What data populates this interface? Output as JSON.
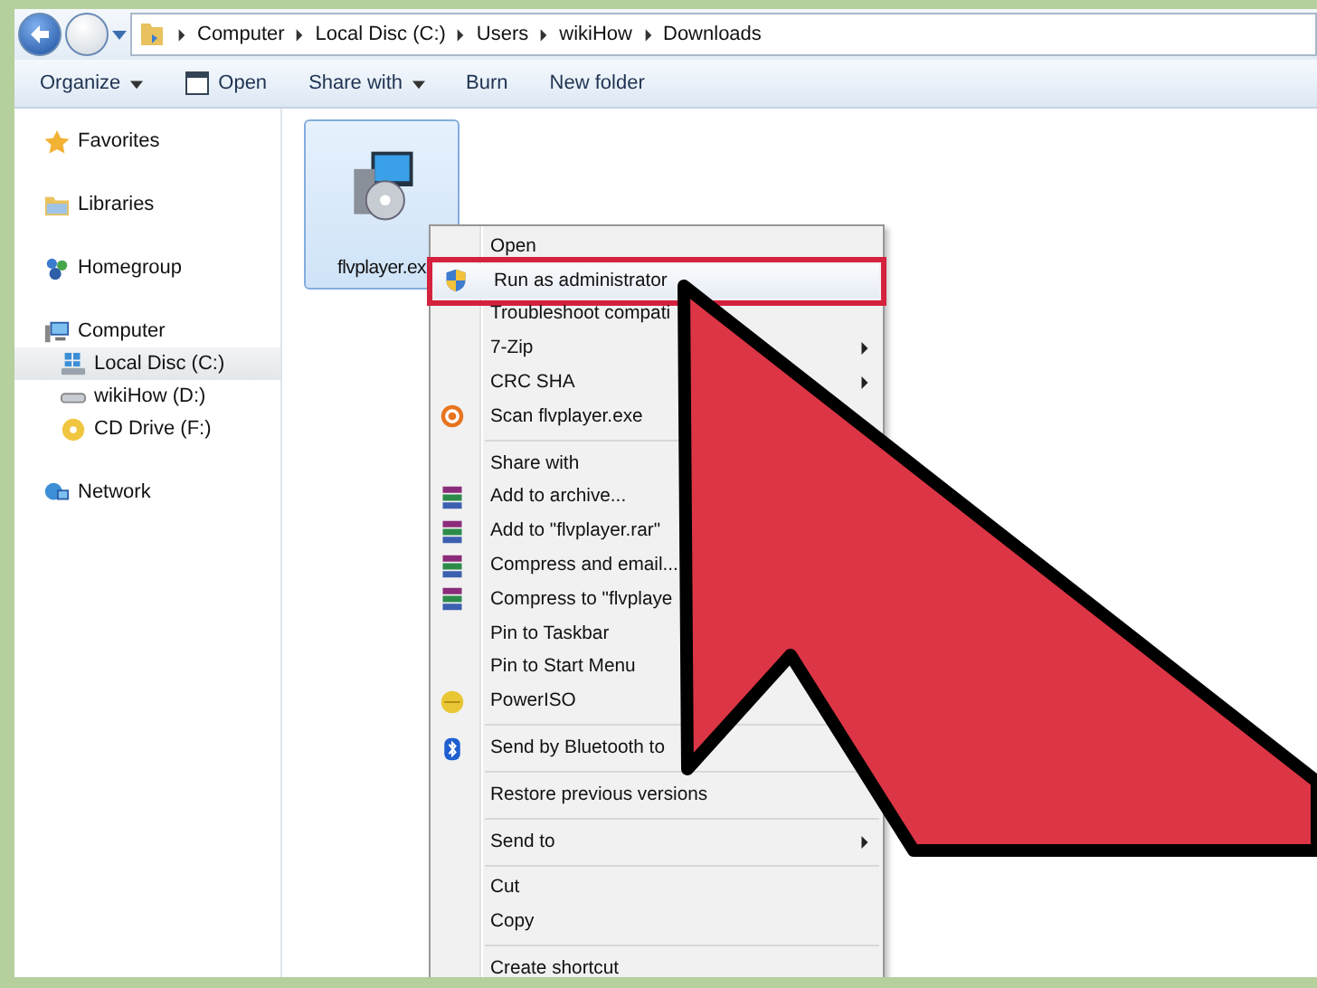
{
  "address_bar": {
    "path": [
      "Computer",
      "Local Disc (C:)",
      "Users",
      "wikiHow",
      "Downloads"
    ]
  },
  "toolbar": [
    {
      "label": "Organize",
      "dropdown": true
    },
    {
      "label": "Open",
      "dropdown": false
    },
    {
      "label": "Share with",
      "dropdown": true
    },
    {
      "label": "Burn",
      "dropdown": false
    },
    {
      "label": "New folder",
      "dropdown": false
    }
  ],
  "sidebar": {
    "items": [
      {
        "label": "Favorites",
        "selected": false
      },
      {
        "label": "Libraries",
        "selected": false
      },
      {
        "label": "Homegroup",
        "selected": false
      },
      {
        "label": "Computer",
        "selected": false,
        "children": [
          {
            "label": "Local Disc (C:)",
            "selected": true
          },
          {
            "label": "wikiHow (D:)",
            "selected": false
          },
          {
            "label": "CD Drive (F:)",
            "selected": false
          }
        ]
      },
      {
        "label": "Network",
        "selected": false
      }
    ]
  },
  "files": [
    {
      "name": "flvplayer.ex",
      "selected": true
    }
  ],
  "context_menu": [
    {
      "kind": "item",
      "label": "Open",
      "submenu": false,
      "selected": false
    },
    {
      "kind": "item",
      "label": "Run as administrator",
      "submenu": false,
      "selected": true
    },
    {
      "kind": "item",
      "label": "Troubleshoot compati",
      "submenu": false,
      "selected": false
    },
    {
      "kind": "item",
      "label": "7-Zip",
      "submenu": true,
      "selected": false
    },
    {
      "kind": "item",
      "label": "CRC SHA",
      "submenu": true,
      "selected": false
    },
    {
      "kind": "item",
      "label": "Scan flvplayer.exe",
      "submenu": false,
      "selected": false
    },
    {
      "kind": "separator"
    },
    {
      "kind": "item",
      "label": "Share with",
      "selected": false
    },
    {
      "kind": "item",
      "label": "Add to archive...",
      "selected": false
    },
    {
      "kind": "item",
      "label": "Add to \"flvplayer.rar\"",
      "selected": false
    },
    {
      "kind": "item",
      "label": "Compress and email...",
      "selected": false
    },
    {
      "kind": "item",
      "label": "Compress to \"flvplaye",
      "selected": false
    },
    {
      "kind": "item",
      "label": "Pin to Taskbar",
      "selected": false
    },
    {
      "kind": "item",
      "label": "Pin to Start Menu",
      "selected": false
    },
    {
      "kind": "item",
      "label": "PowerISO",
      "selected": false
    },
    {
      "kind": "separator"
    },
    {
      "kind": "item",
      "label": "Send by Bluetooth to",
      "selected": false
    },
    {
      "kind": "separator"
    },
    {
      "kind": "item",
      "label": "Restore previous versions",
      "submenu": false,
      "selected": false
    },
    {
      "kind": "separator"
    },
    {
      "kind": "item",
      "label": "Send to",
      "submenu": true,
      "selected": false
    },
    {
      "kind": "separator"
    },
    {
      "kind": "item",
      "label": "Cut",
      "submenu": false,
      "selected": false
    },
    {
      "kind": "item",
      "label": "Copy",
      "submenu": false,
      "selected": false
    },
    {
      "kind": "separator"
    },
    {
      "kind": "item",
      "label": "Create shortcut",
      "submenu": false,
      "selected": false
    }
  ]
}
